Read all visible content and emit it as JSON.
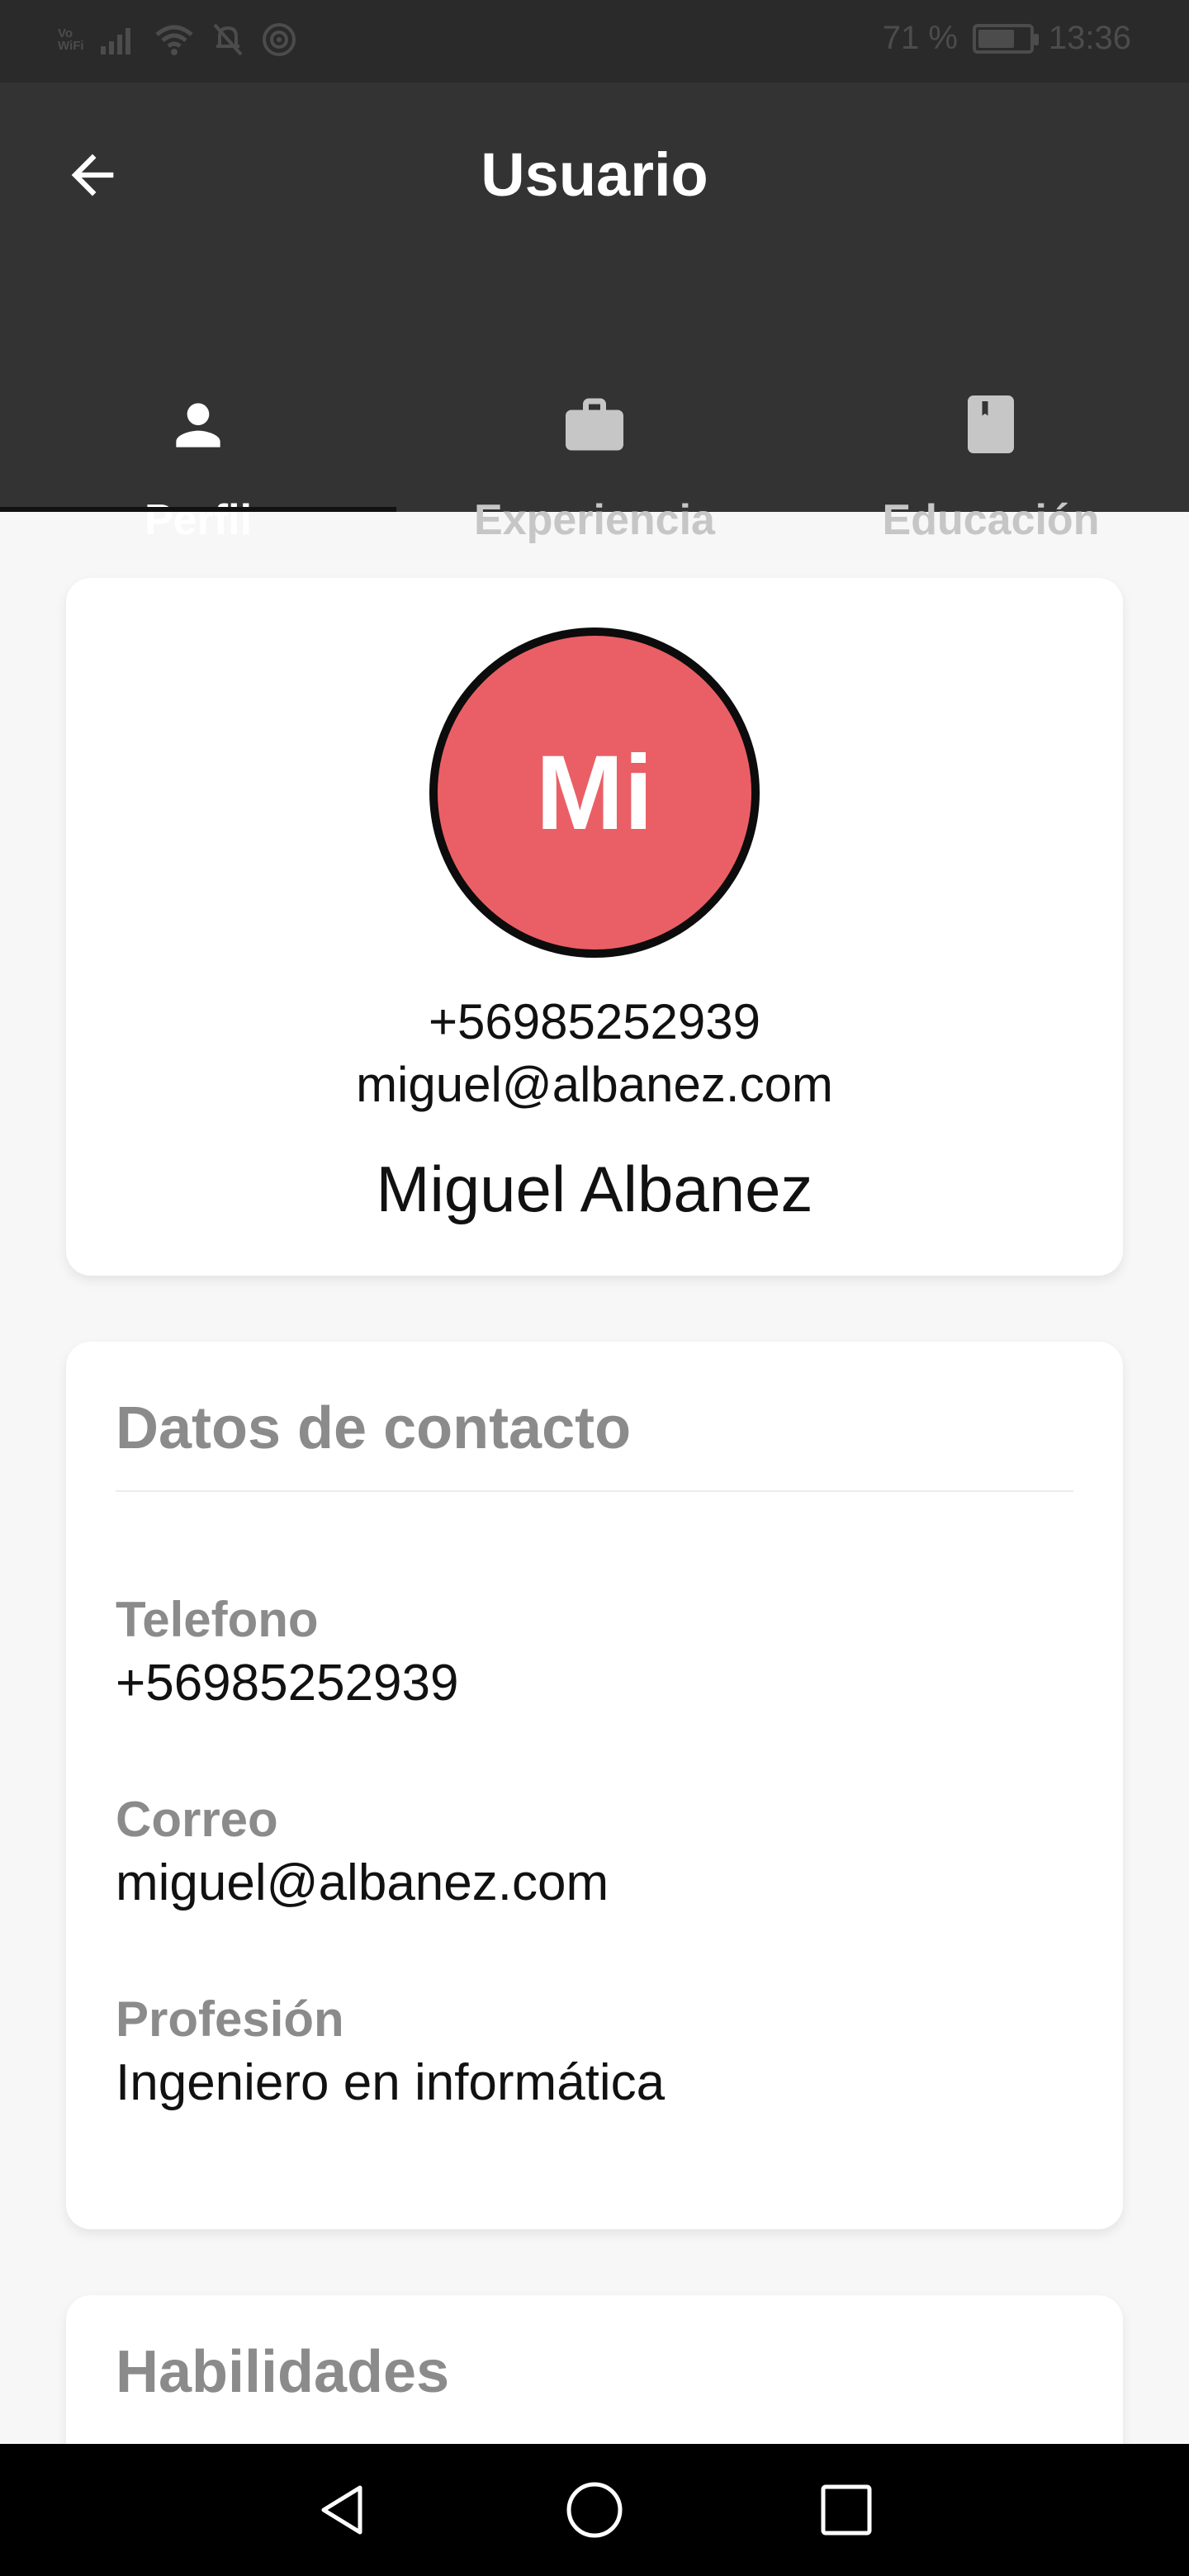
{
  "status_bar": {
    "vowifi_line1": "Vo",
    "vowifi_line2": "WiFi",
    "battery_percent_text": "71 %",
    "battery_level": 0.71,
    "time": "13:36"
  },
  "app_bar": {
    "title": "Usuario",
    "back_icon": "arrow-left-icon"
  },
  "tabs": [
    {
      "label": "Perfil",
      "icon": "person-icon",
      "active": true
    },
    {
      "label": "Experiencia",
      "icon": "briefcase-icon",
      "active": false
    },
    {
      "label": "Educación",
      "icon": "book-icon",
      "active": false
    }
  ],
  "profile": {
    "initials": "Mi",
    "phone": "+56985252939",
    "email": "miguel@albanez.com",
    "name": "Miguel Albanez",
    "avatar_color": "#ea5f65"
  },
  "contact": {
    "title": "Datos de contacto",
    "fields": [
      {
        "label": "Telefono",
        "value": "+56985252939"
      },
      {
        "label": "Correo",
        "value": "miguel@albanez.com"
      },
      {
        "label": "Profesión",
        "value": "Ingeniero en informática"
      }
    ]
  },
  "skills": {
    "title": "Habilidades"
  },
  "colors": {
    "app_bar": "#333333",
    "background": "#f7f7f7",
    "muted_text": "#8b8b8b"
  }
}
